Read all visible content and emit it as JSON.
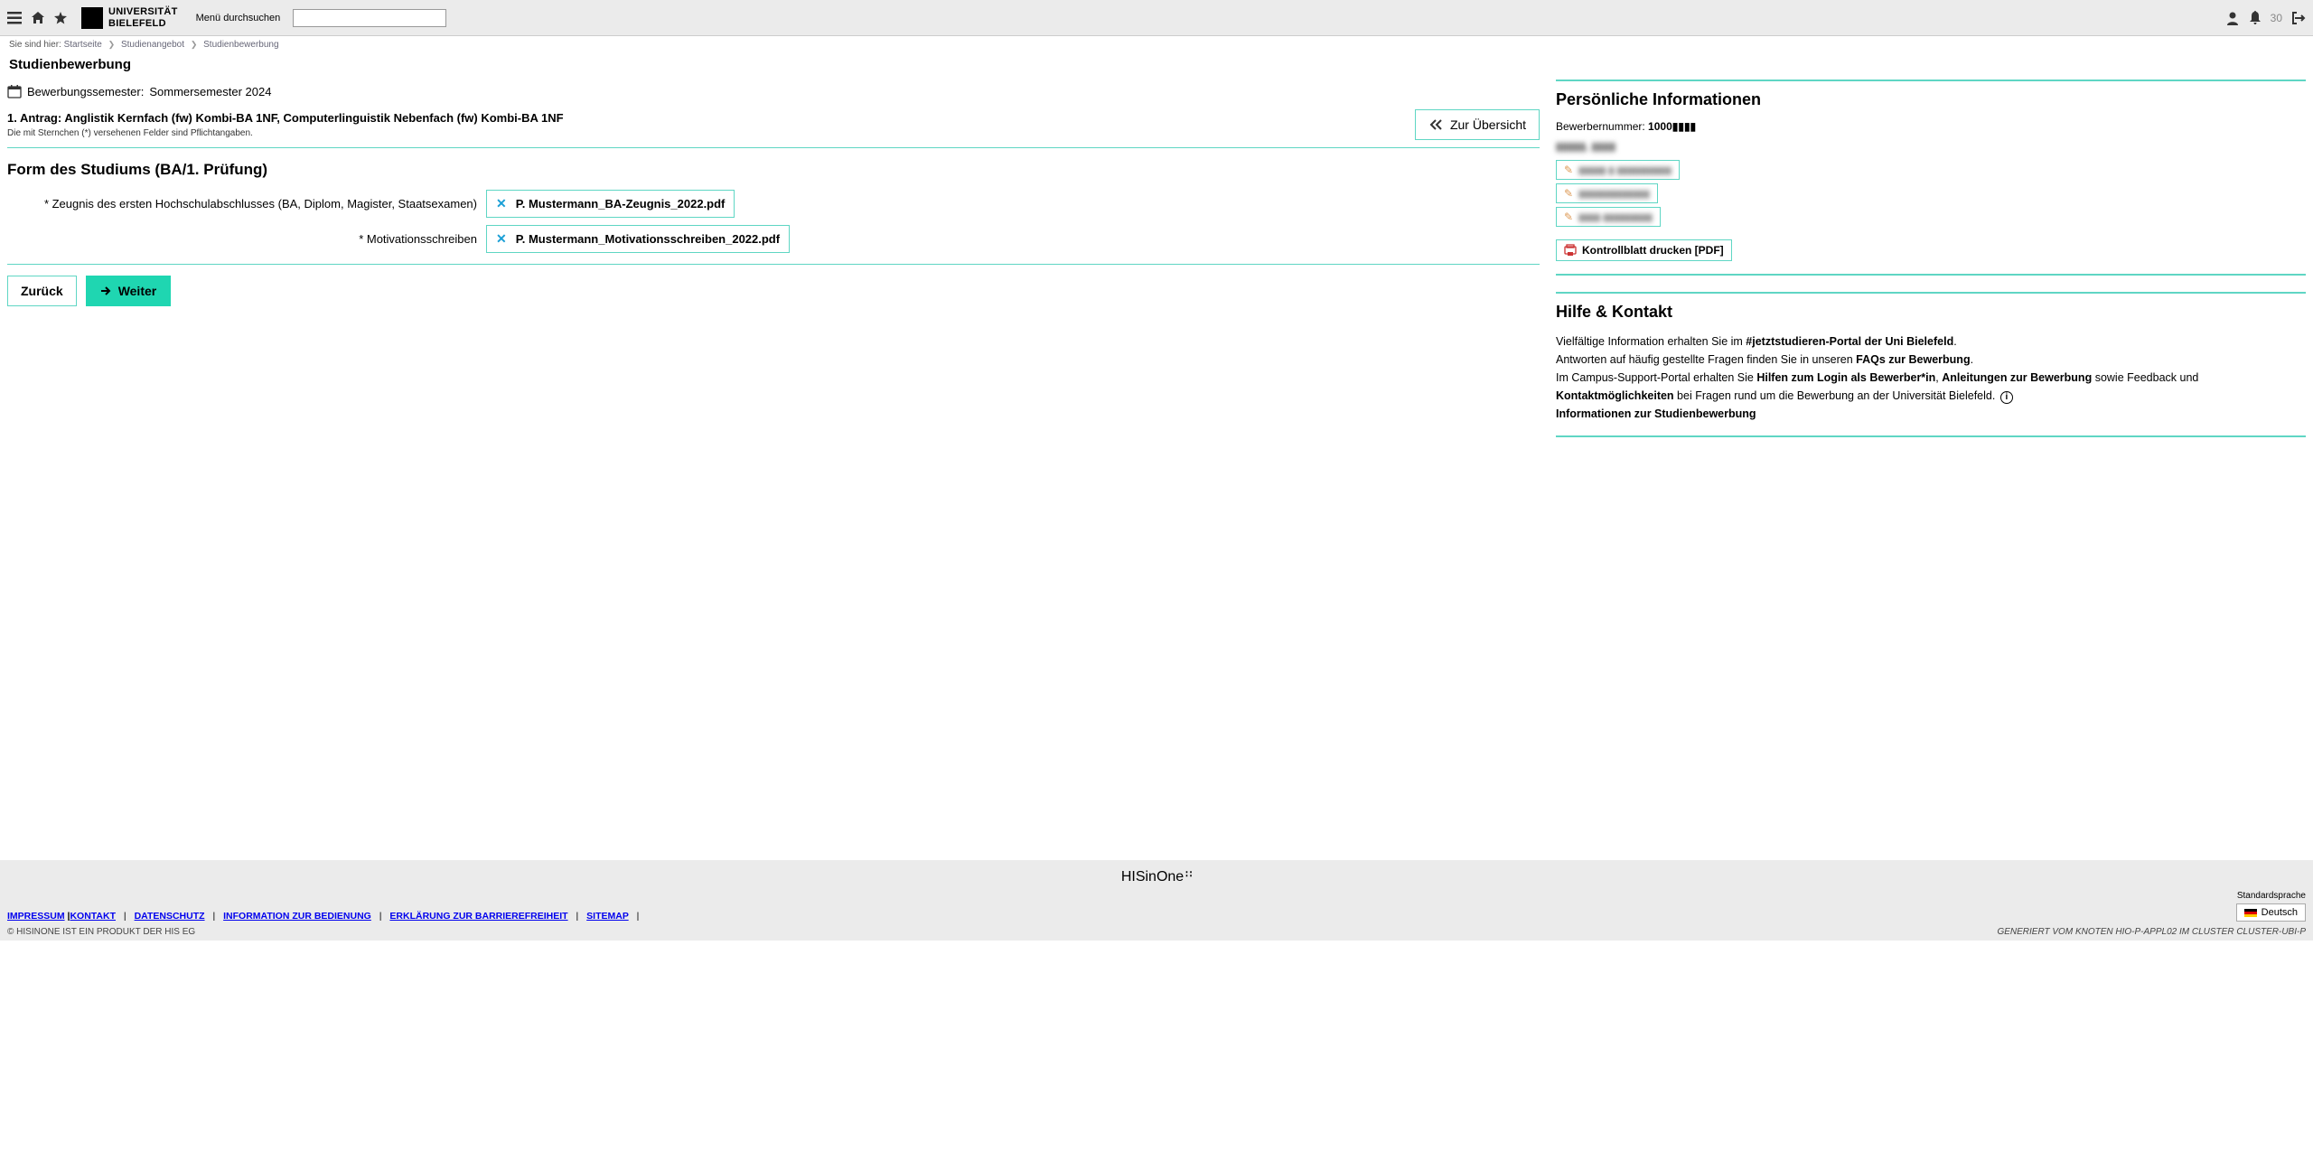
{
  "header": {
    "search_label": "Menü durchsuchen",
    "search_value": "",
    "notification_count": "30",
    "logo_line1": "UNIVERSITÄT",
    "logo_line2": "BIELEFELD"
  },
  "breadcrumb": {
    "prefix": "Sie sind hier:",
    "items": [
      "Startseite",
      "Studienangebot",
      "Studienbewerbung"
    ]
  },
  "page_title": "Studienbewerbung",
  "semester": {
    "label": "Bewerbungssemester:",
    "value": "Sommersemester 2024"
  },
  "antrag": {
    "title": "1. Antrag: Anglistik Kernfach (fw) Kombi-BA 1NF, Computerlinguistik Nebenfach (fw) Kombi-BA 1NF",
    "required_note": "Die mit Sternchen (*) versehenen Felder sind Pflichtangaben.",
    "overview_btn": "Zur Übersicht"
  },
  "section": {
    "title": "Form des Studiums (BA/1. Prüfung)",
    "uploads": [
      {
        "label": "* Zeugnis des ersten Hochschulabschlusses (BA, Diplom, Magister, Staatsexamen)",
        "file": "P. Mustermann_BA-Zeugnis_2022.pdf"
      },
      {
        "label": "* Motivationsschreiben",
        "file": "P. Mustermann_Motivationsschreiben_2022.pdf"
      }
    ]
  },
  "nav": {
    "back": "Zurück",
    "next": "Weiter"
  },
  "sidebar": {
    "personal": {
      "title": "Persönliche Informationen",
      "applicant_label": "Bewerbernummer:",
      "applicant_no": "1000▮▮▮▮",
      "name": "▮▮▮▮▮, ▮▮▮▮",
      "edits": [
        "▮▮▮▮▮ ▮ ▮▮▮▮▮▮▮▮▮▮",
        "▮▮▮▮▮▮▮▮▮▮▮▮▮",
        "▮▮▮▮ ▮▮▮▮▮▮▮▮▮"
      ],
      "print": "Kontrollblatt drucken [PDF]"
    },
    "help": {
      "title": "Hilfe & Kontakt",
      "t1a": "Vielfältige Information erhalten Sie im ",
      "l1": "#jetztstudieren-Portal der Uni Bielefeld",
      "t2a": "Antworten auf häufig gestellte Fragen finden Sie in unseren ",
      "l2": "FAQs zur Bewerbung",
      "t3a": "Im Campus-Support-Portal erhalten Sie ",
      "l3": "Hilfen zum Login als Bewerber*in",
      "t3b": ", ",
      "l4": "Anleitungen zur Bewerbung",
      "t3c": " so­wie Feedback und ",
      "l5": "Kontaktmöglichkeiten",
      "t3d": " bei Fragen rund um die Bewerbung an der Universität Bielefeld.",
      "l6": "Informationen zur Studienbewerbung"
    }
  },
  "footer": {
    "brand": "HISinOne",
    "links": [
      "IMPRESSUM",
      "KONTAKT",
      "DATENSCHUTZ",
      "INFORMATION ZUR BEDIENUNG",
      "ERKLÄRUNG ZUR BARRIEREFREIHEIT",
      "SITEMAP"
    ],
    "lang_label": "Standardsprache",
    "lang_value": "Deutsch",
    "copyright": "© HISINONE IST EIN PRODUKT DER HIS EG",
    "generated": "GENERIERT VOM KNOTEN HIO-P-APPL02 IM CLUSTER CLUSTER-UBI-P"
  }
}
